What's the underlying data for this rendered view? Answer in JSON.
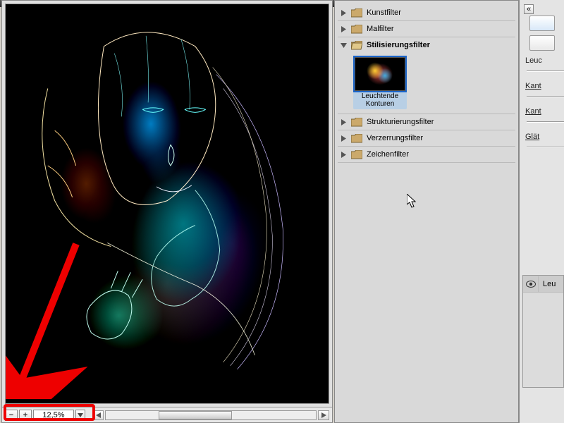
{
  "zoom": {
    "value": "12,5%"
  },
  "categories": [
    {
      "id": "kunstfilter",
      "label": "Kunstfilter",
      "expanded": false
    },
    {
      "id": "malfilter",
      "label": "Malfilter",
      "expanded": false
    },
    {
      "id": "stilisierung",
      "label": "Stilisierungsfilter",
      "expanded": true
    },
    {
      "id": "struktur",
      "label": "Strukturierungsfilter",
      "expanded": false
    },
    {
      "id": "verzerrung",
      "label": "Verzerrungsfilter",
      "expanded": false
    },
    {
      "id": "zeichen",
      "label": "Zeichenfilter",
      "expanded": false
    }
  ],
  "filters": {
    "stilisierung": [
      {
        "id": "leuchtende-konturen",
        "label": "Leuchtende Konturen",
        "selected": true
      }
    ]
  },
  "options": {
    "title_partial": "Leuc",
    "param1_label": "Kant",
    "param2_label": "Kant",
    "param3_label": "Glät"
  },
  "layer": {
    "row_label": "Leu"
  }
}
